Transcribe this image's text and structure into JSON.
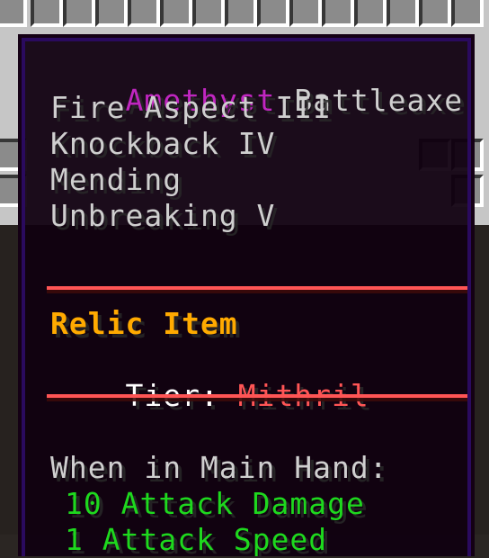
{
  "tooltip": {
    "name_prefix": "Amethyst",
    "name_suffix": "Battleaxe",
    "enchantments": [
      "Fire Aspect III",
      "Knockback IV",
      "Mending",
      "Unbreaking V"
    ],
    "relic_label": "Relic Item",
    "tier_label": "Tier:",
    "tier_value": "Mithril",
    "hand_header": "When in Main Hand:",
    "attack_damage": "10 Attack Damage",
    "attack_speed": "1 Attack Speed"
  },
  "colors": {
    "name_prefix": "#c026c0",
    "relic": "#ffaa00",
    "tier_value": "#ff5555",
    "stats": "#1ed81e",
    "divider": "#ff5555"
  }
}
